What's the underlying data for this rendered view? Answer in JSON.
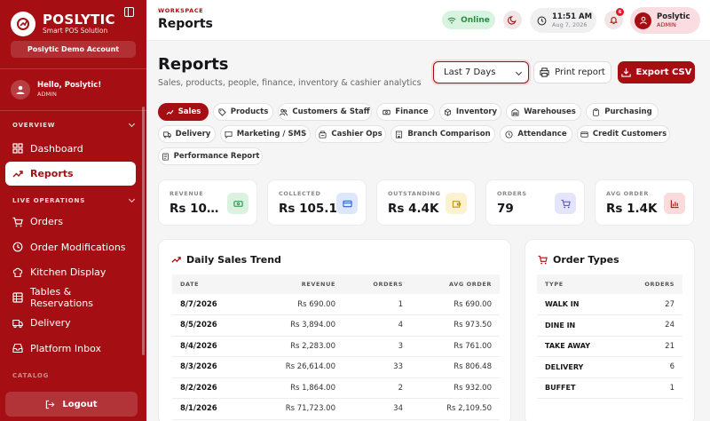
{
  "app": {
    "name": "POSLYTIC",
    "tagline": "Smart POS Solution",
    "account": "Poslytic Demo Account"
  },
  "user": {
    "greeting": "Hello, Poslytic!",
    "role": "ADMIN"
  },
  "sidebar": {
    "sections": [
      {
        "label": "OVERVIEW",
        "items": [
          "Dashboard",
          "Reports"
        ]
      },
      {
        "label": "LIVE OPERATIONS",
        "items": [
          "Orders",
          "Order Modifications",
          "Kitchen Display",
          "Tables & Reservations",
          "Delivery",
          "Platform Inbox"
        ]
      },
      {
        "label": "CATALOG"
      }
    ],
    "active": "Reports",
    "logout": "Logout"
  },
  "header": {
    "crumb": "WORKSPACE",
    "title": "Reports",
    "status": "Online",
    "time": "11:51 AM",
    "date": "Aug 7, 2026",
    "notifications": "6",
    "user_name": "Poslytic",
    "user_role": "ADMIN"
  },
  "page": {
    "title": "Reports",
    "subtitle": "Sales, products, people, finance, inventory & cashier analytics",
    "range": "Last 7 Days",
    "print": "Print report",
    "export": "Export CSV"
  },
  "tabs": [
    "Sales",
    "Products",
    "Customers & Staff",
    "Finance",
    "Inventory",
    "Warehouses",
    "Purchasing",
    "Delivery",
    "Marketing / SMS",
    "Cashier Ops",
    "Branch Comparison",
    "Attendance",
    "Credit Customers",
    "Performance Report"
  ],
  "stats": [
    {
      "label": "REVENUE",
      "value": "Rs 109...."
    },
    {
      "label": "COLLECTED",
      "value": "Rs 105.1K"
    },
    {
      "label": "OUTSTANDING",
      "value": "Rs 4.4K"
    },
    {
      "label": "ORDERS",
      "value": "79"
    },
    {
      "label": "AVG ORDER",
      "value": "Rs 1.4K"
    }
  ],
  "colors": {
    "brand": "#a50e12",
    "online": "#2d8a45"
  },
  "sales_trend": {
    "title": "Daily Sales Trend",
    "columns": [
      "DATE",
      "REVENUE",
      "ORDERS",
      "AVG ORDER"
    ],
    "rows": [
      [
        "8/7/2026",
        "Rs 690.00",
        "1",
        "Rs 690.00"
      ],
      [
        "8/5/2026",
        "Rs 3,894.00",
        "4",
        "Rs 973.50"
      ],
      [
        "8/4/2026",
        "Rs 2,283.00",
        "3",
        "Rs 761.00"
      ],
      [
        "8/3/2026",
        "Rs 26,614.00",
        "33",
        "Rs 806.48"
      ],
      [
        "8/2/2026",
        "Rs 1,864.00",
        "2",
        "Rs 932.00"
      ],
      [
        "8/1/2026",
        "Rs 71,723.00",
        "34",
        "Rs 2,109.50"
      ]
    ]
  },
  "order_types": {
    "title": "Order Types",
    "columns": [
      "TYPE",
      "ORDERS"
    ],
    "rows": [
      [
        "WALK IN",
        "27"
      ],
      [
        "DINE IN",
        "24"
      ],
      [
        "TAKE AWAY",
        "21"
      ],
      [
        "DELIVERY",
        "6"
      ],
      [
        "BUFFET",
        "1"
      ]
    ]
  }
}
